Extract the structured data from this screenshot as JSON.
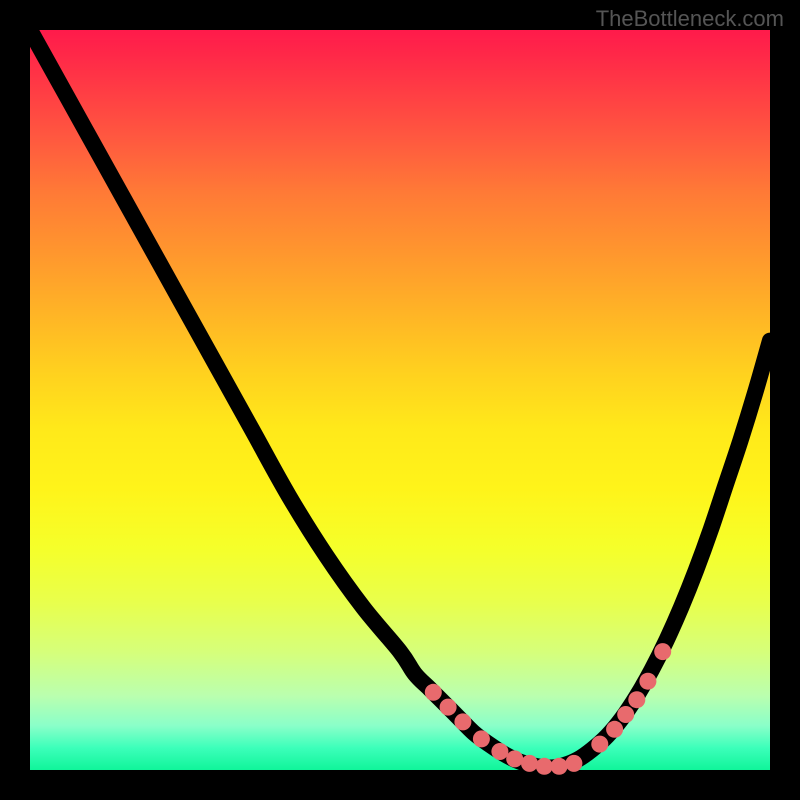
{
  "attribution": "TheBottleneck.com",
  "colors": {
    "gradient_top": "#ff1a4b",
    "gradient_bottom": "#10f59a",
    "dot": "#e86a6d",
    "curve": "#000000",
    "frame": "#000000"
  },
  "chart_data": {
    "type": "line",
    "title": "",
    "xlabel": "",
    "ylabel": "",
    "xlim": [
      0,
      100
    ],
    "ylim": [
      0,
      100
    ],
    "x": [
      0,
      5,
      10,
      15,
      20,
      25,
      30,
      35,
      40,
      45,
      50,
      52,
      54,
      56,
      58,
      60,
      62,
      64,
      66,
      68,
      70,
      72,
      74,
      76,
      78,
      80,
      82,
      84,
      86,
      88,
      90,
      92,
      94,
      96,
      98,
      100
    ],
    "y": [
      100,
      91,
      82,
      73,
      64,
      55,
      46,
      37,
      29,
      22,
      16,
      13,
      11,
      9,
      7,
      5,
      3.5,
      2.2,
      1.2,
      0.6,
      0.3,
      0.6,
      1.4,
      2.8,
      4.6,
      7.0,
      10,
      13.5,
      17.5,
      22,
      27,
      32.5,
      38.5,
      44.5,
      51,
      58
    ],
    "markers": {
      "x": [
        54.5,
        56.5,
        58.5,
        61,
        63.5,
        65.5,
        67.5,
        69.5,
        71.5,
        73.5,
        77,
        79,
        80.5,
        82,
        83.5,
        85.5
      ],
      "y": [
        10.5,
        8.5,
        6.5,
        4.2,
        2.5,
        1.5,
        0.9,
        0.5,
        0.5,
        0.9,
        3.5,
        5.5,
        7.5,
        9.5,
        12,
        16
      ]
    }
  }
}
